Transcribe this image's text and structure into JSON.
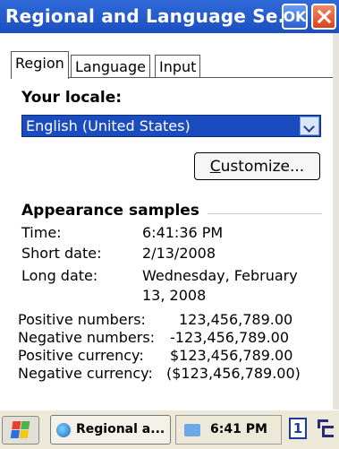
{
  "window": {
    "title": "Regional and Language Se...",
    "ok_label": "OK"
  },
  "tabs": [
    {
      "label": "Region",
      "active": true
    },
    {
      "label": "Language",
      "active": false
    },
    {
      "label": "Input",
      "active": false
    }
  ],
  "locale": {
    "label": "Your locale:",
    "selected": "English (United States)"
  },
  "customize": {
    "accel": "C",
    "rest": "ustomize..."
  },
  "samples": {
    "heading": "Appearance samples",
    "time_label": "Time:",
    "time_value": "6:41:36 PM",
    "short_date_label": "Short date:",
    "short_date_value": "2/13/2008",
    "long_date_label": "Long date:",
    "long_date_value_line1": "Wednesday, February",
    "long_date_value_line2": "13, 2008",
    "pos_num_label": "Positive numbers:",
    "pos_num_value": "123,456,789.00",
    "neg_num_label": "Negative numbers:",
    "neg_num_value": "-123,456,789.00",
    "pos_cur_label": "Positive currency:",
    "pos_cur_value": "$123,456,789.00",
    "neg_cur_label": "Negative currency:",
    "neg_cur_value": "($123,456,789.00)"
  },
  "taskbar": {
    "task_label": "Regional a...",
    "clock": "6:41 PM",
    "desktop_number": "1"
  },
  "colors": {
    "title_blue": "#1c4fc0",
    "selection_blue": "#1a4cc0",
    "close_red": "#d8431b"
  },
  "icons": {
    "start": "windows-flag-icon",
    "task": "globe-icon",
    "tray": "network-icon",
    "desktop": "desktop-switch-icon"
  }
}
